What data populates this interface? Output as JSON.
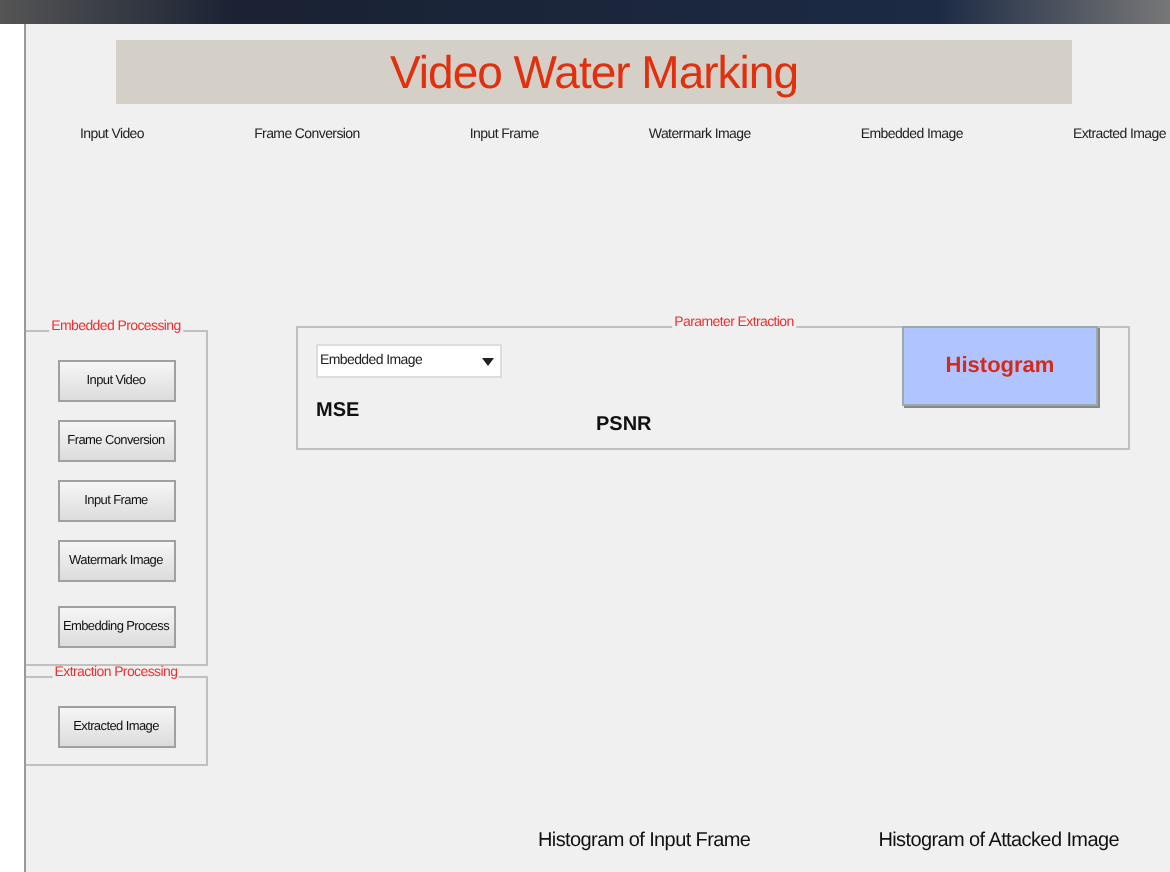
{
  "title": "Video Water Marking",
  "frame_labels": [
    "Input Video",
    "Frame Conversion",
    "Input Frame",
    "Watermark Image",
    "Embedded Image",
    "Extracted Image"
  ],
  "embedded_processing": {
    "title": "Embedded Processing",
    "buttons": [
      "Input Video",
      "Frame Conversion",
      "Input Frame",
      "Watermark Image",
      "Embedding Process"
    ]
  },
  "extraction_processing": {
    "title": "Extraction  Processing",
    "buttons": [
      "Extracted Image"
    ]
  },
  "parameter_extraction": {
    "title": "Parameter Extraction",
    "dropdown": {
      "value": "Embedded Image"
    },
    "metrics": [
      "MSE",
      "PSNR"
    ]
  },
  "histogram_button": "Histogram",
  "bottom_labels": [
    "Histogram of Input Frame",
    "Histogram of Attacked Image"
  ]
}
